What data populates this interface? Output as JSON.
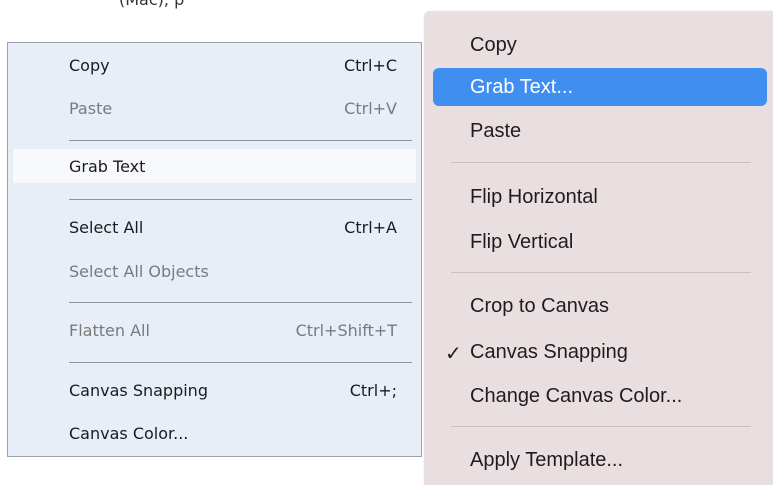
{
  "cropped_text": "(Mac), p",
  "windows_menu": {
    "items": [
      {
        "label": "Copy",
        "shortcut": "Ctrl+C"
      },
      {
        "label": "Paste",
        "shortcut": "Ctrl+V"
      },
      {
        "label": "Grab Text",
        "shortcut": ""
      },
      {
        "label": "Select All",
        "shortcut": "Ctrl+A"
      },
      {
        "label": "Select All Objects",
        "shortcut": ""
      },
      {
        "label": "Flatten All",
        "shortcut": "Ctrl+Shift+T"
      },
      {
        "label": "Canvas Snapping",
        "shortcut": "Ctrl+;"
      },
      {
        "label": "Canvas Color...",
        "shortcut": ""
      }
    ]
  },
  "mac_menu": {
    "check_mark": "✓",
    "items": [
      {
        "label": "Copy"
      },
      {
        "label": "Grab Text..."
      },
      {
        "label": "Paste"
      },
      {
        "label": "Flip Horizontal"
      },
      {
        "label": "Flip Vertical"
      },
      {
        "label": "Crop to Canvas"
      },
      {
        "label": "Canvas Snapping"
      },
      {
        "label": "Change Canvas Color..."
      },
      {
        "label": "Apply Template..."
      }
    ]
  },
  "colors": {
    "windows_menu_bg": "#e8eef7",
    "windows_hover_bg": "#f7f9fc",
    "mac_menu_bg": "#eadfe0",
    "mac_selection": "#3f8ef0"
  }
}
